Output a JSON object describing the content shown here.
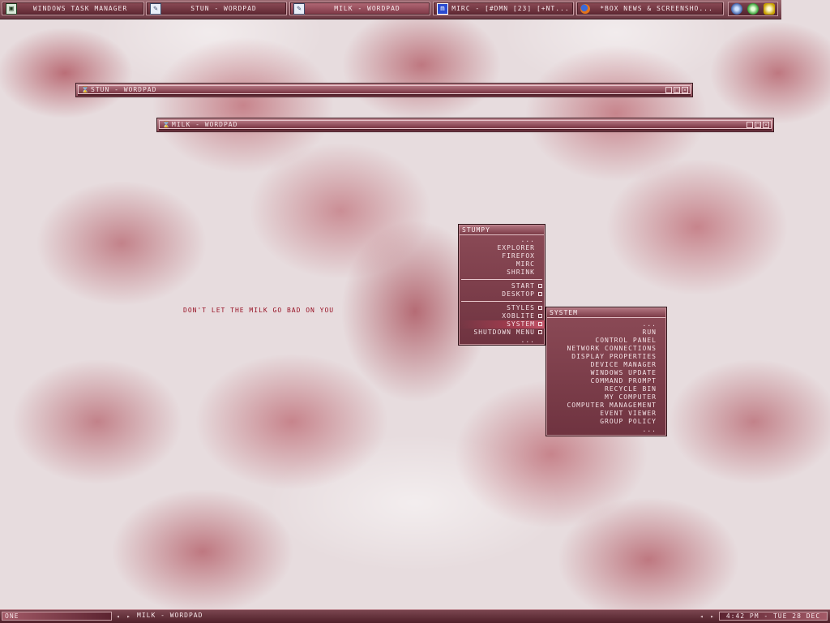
{
  "taskbar": {
    "buttons": [
      {
        "label": "WINDOWS TASK MANAGER",
        "icon": "monitor-icon"
      },
      {
        "label": "STUN - WORDPAD",
        "icon": "document-icon"
      },
      {
        "label": "MILK - WORDPAD",
        "icon": "document-icon"
      },
      {
        "label": "MIRC - [#DMN [23] [+NT...",
        "icon": "mirc-icon"
      },
      {
        "label": "*BOX NEWS & SCREENSHO...",
        "icon": "firefox-icon"
      }
    ],
    "tray_icons": [
      "network-tray-icon",
      "update-tray-icon",
      "security-tray-icon"
    ],
    "icon_glyphs": {
      "monitor": "▣",
      "document": "✎",
      "mirc": "m",
      "window": "⌛",
      "minimize": "_",
      "maximize": "□",
      "close": "×"
    }
  },
  "windows": [
    {
      "title": "STUN - WORDPAD"
    },
    {
      "title": "MILK - WORDPAD"
    }
  ],
  "menu_main": {
    "title": "STUMPY",
    "items": [
      {
        "label": "...",
        "submenu": false
      },
      {
        "label": "EXPLORER",
        "submenu": false
      },
      {
        "label": "FIREFOX",
        "submenu": false
      },
      {
        "label": "MIRC",
        "submenu": false
      },
      {
        "label": "SHRINK",
        "submenu": false
      },
      {
        "separator": true
      },
      {
        "label": "START",
        "submenu": true
      },
      {
        "label": "DESKTOP",
        "submenu": true
      },
      {
        "separator": true
      },
      {
        "label": "STYLES",
        "submenu": true
      },
      {
        "label": "XOBLITE",
        "submenu": true
      },
      {
        "label": "SYSTEM",
        "submenu": true,
        "highlight": true
      },
      {
        "label": "SHUTDOWN MENU",
        "submenu": true
      },
      {
        "label": "...",
        "submenu": false
      }
    ]
  },
  "menu_system": {
    "title": "SYSTEM",
    "items": [
      "...",
      "RUN",
      "CONTROL PANEL",
      "NETWORK CONNECTIONS",
      "DISPLAY PROPERTIES",
      "DEVICE MANAGER",
      "WINDOWS UPDATE",
      "COMMAND PROMPT",
      "RECYCLE BIN",
      "MY COMPUTER",
      "COMPUTER MANAGEMENT",
      "EVENT VIEWER",
      "GROUP POLICY",
      "..."
    ]
  },
  "desktop": {
    "slogan": "DON'T LET THE MILK GO BAD ON YOU"
  },
  "bottombar": {
    "workspace": "ONE",
    "arrows": {
      "left": "◂",
      "right": "▸"
    },
    "current_window": "MILK - WORDPAD",
    "clock": "4:42 PM - TUE 28 DEC"
  },
  "colors": {
    "accent": "#8c4b57",
    "highlight": "#a63c4f",
    "wallpaper_red": "#961423"
  }
}
